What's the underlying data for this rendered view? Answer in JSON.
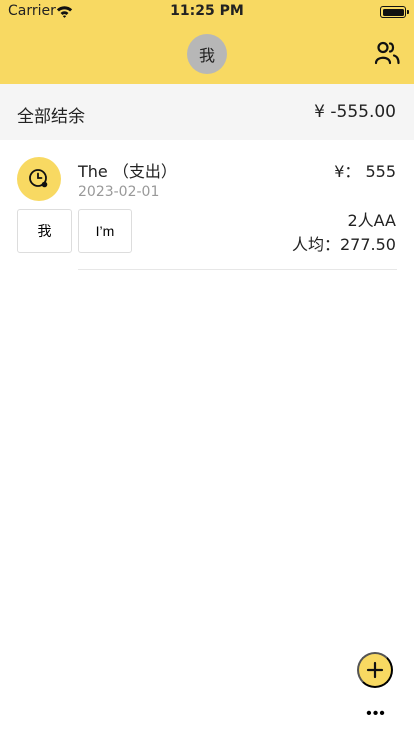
{
  "status_bar": {
    "carrier": "Carrier",
    "time": "11:25 PM"
  },
  "header": {
    "avatar_text": "我",
    "users_icon": "users-icon",
    "background": "#f8d962"
  },
  "balance": {
    "label": "全部结余",
    "value": "¥ -555.00"
  },
  "records": [
    {
      "title": "The （支出）",
      "date": "2023-02-01",
      "amount": "¥： 555",
      "split": "2人AA",
      "average": "人均：277.50",
      "participants": [
        "我",
        "I’m"
      ],
      "icon": "clock-icon"
    }
  ],
  "actions": {
    "add_icon": "plus-icon",
    "more_icon": "more-icon",
    "more_text": "•••"
  }
}
